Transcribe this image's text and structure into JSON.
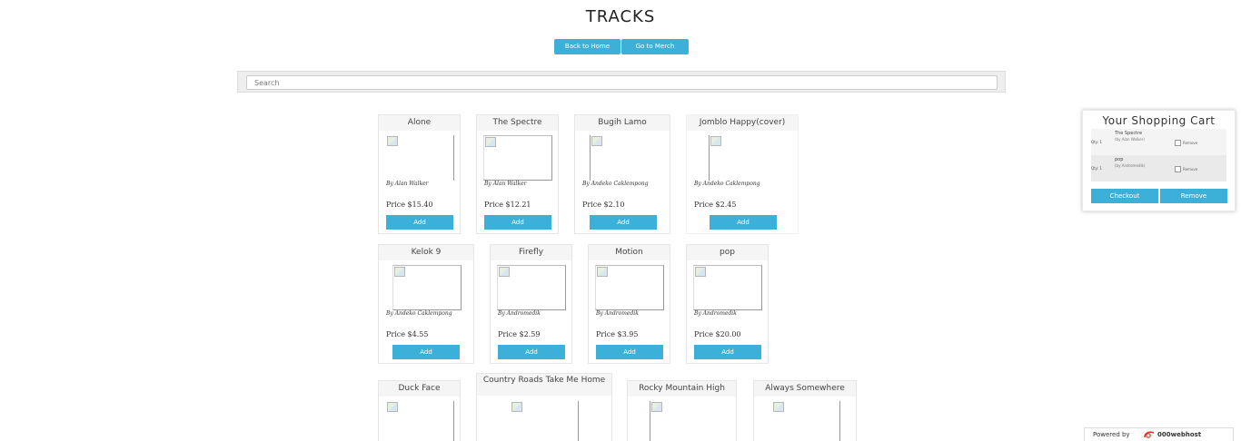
{
  "header": {
    "title": "TRACKS",
    "back_home_label": "Back to Home",
    "merch_label": "Go to Merch"
  },
  "search": {
    "placeholder": "Search",
    "value": ""
  },
  "tracks": [
    {
      "title": "Alone",
      "artist": "By Alan Walker",
      "price": "Price $15.40",
      "add_label": "Add"
    },
    {
      "title": "The Spectre",
      "artist": "By Alan Walker",
      "price": "Price $12.21",
      "add_label": "Add"
    },
    {
      "title": "Bugih Lamo",
      "artist": "By Andeko Caklempong",
      "price": "Price $2.10",
      "add_label": "Add"
    },
    {
      "title": "Jomblo Happy(cover)",
      "artist": "By Andeko Caklempong",
      "price": "Price $2.45",
      "add_label": "Add"
    },
    {
      "title": "Kelok 9",
      "artist": "By Andeko Caklempong",
      "price": "Price $4.55",
      "add_label": "Add"
    },
    {
      "title": "Firefly",
      "artist": "By Andromedik",
      "price": "Price $2.59",
      "add_label": "Add"
    },
    {
      "title": "Motion",
      "artist": "By Andromedik",
      "price": "Price $3.95",
      "add_label": "Add"
    },
    {
      "title": "pop",
      "artist": "By Andromedik",
      "price": "Price $20.00",
      "add_label": "Add"
    },
    {
      "title": "Duck Face"
    },
    {
      "title": "Country Roads Take Me Home"
    },
    {
      "title": "Rocky Mountain High"
    },
    {
      "title": "Always Somewhere"
    }
  ],
  "cart": {
    "title": "Your Shopping Cart",
    "items": [
      {
        "qty": "Qty: 1",
        "name": "The Spectre",
        "by": "(by Alan Walker)",
        "remove_label": "Remove"
      },
      {
        "qty": "Qty: 1",
        "name": "pop",
        "by": "(by Andromedik)",
        "remove_label": "Remove"
      }
    ],
    "checkout_label": "Checkout",
    "remove_label": "Remove"
  },
  "footer": {
    "powered_by": "Powered by",
    "host_name": "000webhost",
    "host_logo_icon": "webhost-logo-icon",
    "accent_color": "#3cb0d8"
  }
}
